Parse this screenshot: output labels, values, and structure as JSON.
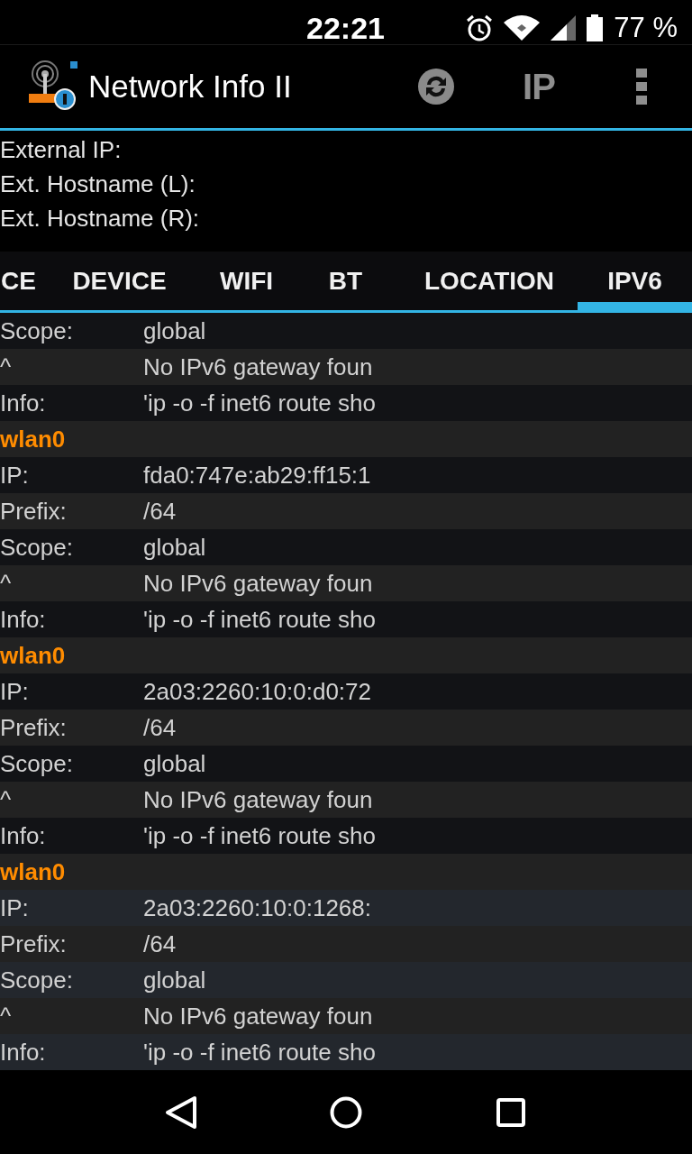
{
  "status_bar": {
    "time": "22:21",
    "battery": "77 %"
  },
  "app_bar": {
    "title": "Network Info II",
    "actions": [
      {
        "kind": "refresh"
      },
      {
        "kind": "ip",
        "label": "IP"
      },
      {
        "kind": "overflow"
      }
    ]
  },
  "external": [
    "External IP:",
    "Ext. Hostname (L):",
    "Ext. Hostname (R):"
  ],
  "tabs": [
    {
      "label": "CE",
      "selected": false
    },
    {
      "label": "DEVICE",
      "selected": false
    },
    {
      "label": "WIFI",
      "selected": false
    },
    {
      "label": "BT",
      "selected": false
    },
    {
      "label": "LOCATION",
      "selected": false
    },
    {
      "label": "IPV6",
      "selected": true
    }
  ],
  "rows": [
    {
      "kind": "field",
      "label": "Scope:",
      "value": "global"
    },
    {
      "kind": "field",
      "label": "^",
      "value": "No IPv6 gateway foun"
    },
    {
      "kind": "field",
      "label": "Info:",
      "value": "'ip -o -f inet6 route sho"
    },
    {
      "kind": "header",
      "label": "wlan0"
    },
    {
      "kind": "field",
      "label": "IP:",
      "value": "fda0:747e:ab29:ff15:1"
    },
    {
      "kind": "field",
      "label": "Prefix:",
      "value": "/64"
    },
    {
      "kind": "field",
      "label": "Scope:",
      "value": "global"
    },
    {
      "kind": "field",
      "label": "^",
      "value": "No IPv6 gateway foun"
    },
    {
      "kind": "field",
      "label": "Info:",
      "value": "'ip -o -f inet6 route sho"
    },
    {
      "kind": "header",
      "label": "wlan0"
    },
    {
      "kind": "field",
      "label": "IP:",
      "value": "2a03:2260:10:0:d0:72"
    },
    {
      "kind": "field",
      "label": "Prefix:",
      "value": "/64"
    },
    {
      "kind": "field",
      "label": "Scope:",
      "value": "global"
    },
    {
      "kind": "field",
      "label": "^",
      "value": "No IPv6 gateway foun"
    },
    {
      "kind": "field",
      "label": "Info:",
      "value": "'ip -o -f inet6 route sho"
    },
    {
      "kind": "header",
      "label": "wlan0"
    },
    {
      "kind": "field",
      "label": "IP:",
      "value": "2a03:2260:10:0:1268:"
    },
    {
      "kind": "field",
      "label": "Prefix:",
      "value": "/64"
    },
    {
      "kind": "field",
      "label": "Scope:",
      "value": "global"
    },
    {
      "kind": "field",
      "label": "^",
      "value": "No IPv6 gateway foun"
    },
    {
      "kind": "field",
      "label": "Info:",
      "value": "'ip -o -f inet6 route sho"
    }
  ]
}
